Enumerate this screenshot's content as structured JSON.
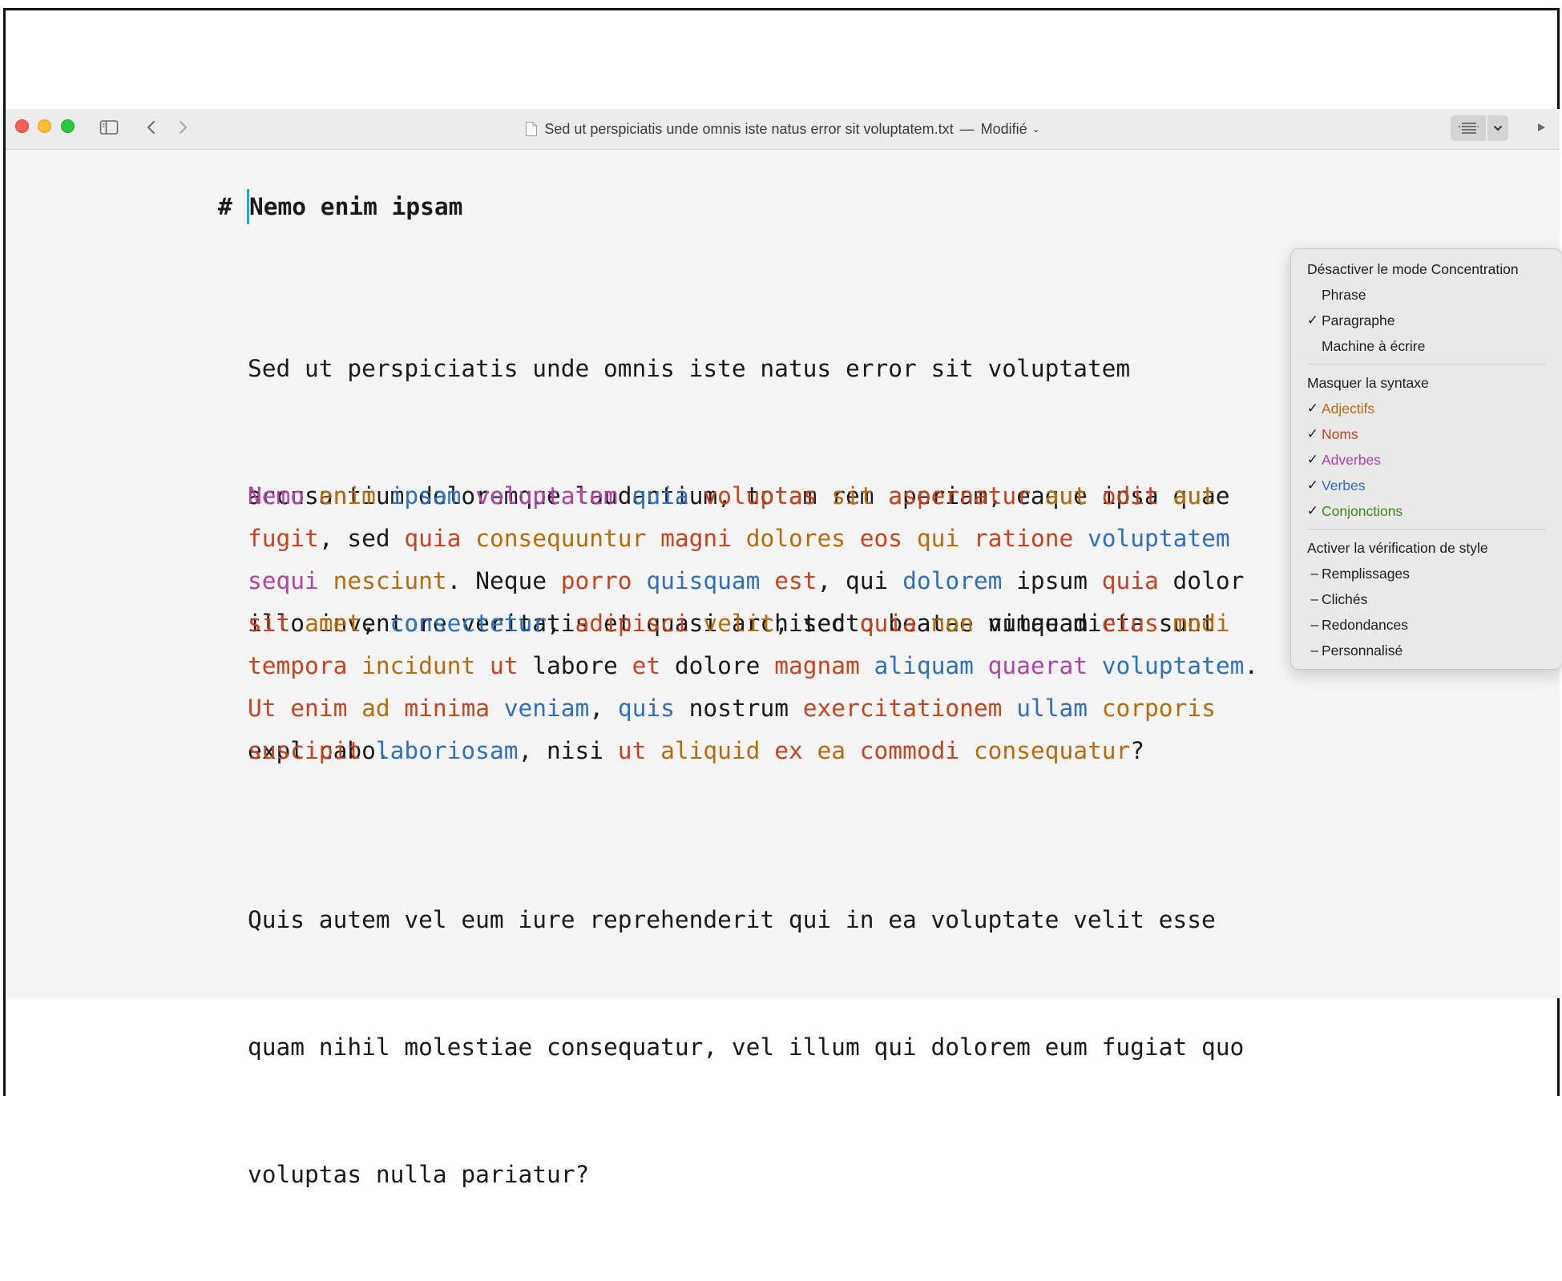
{
  "window": {
    "title": "Sed ut perspiciatis unde omnis iste natus error sit voluptatem.txt",
    "title_separator": "—",
    "status": "Modifié",
    "status_chevron": "⌄"
  },
  "toolbar": {
    "sidebar_icon": "sidebar-icon",
    "back_icon": "chevron-left-icon",
    "forward_icon": "chevron-right-icon",
    "focus_icon": "focus-mode-icon",
    "dropdown_icon": "chevron-down-icon",
    "play_icon": "play-icon"
  },
  "colors": {
    "nouns": "#c8431d",
    "adjectives": "#b96b0c",
    "adverbs": "#b341a8",
    "verbs": "#2f6fbf",
    "conjunctions": "#3b8a1c",
    "caret": "#1aa7e8"
  },
  "editor": {
    "heading_marker": "#",
    "heading_text": "Nemo enim ipsam",
    "paragraph1": [
      "Sed ut perspiciatis unde omnis iste natus error sit voluptatem",
      "accusantium doloremque laudantium, totam rem aperiam, eaque ipsa quae",
      "illo inventore veritatis et quasi architecto beatae vitae dicta sunt",
      "explicabo."
    ],
    "paragraph2": [
      [
        [
          "Nemo",
          "adv"
        ],
        [
          " ",
          "plain"
        ],
        [
          "enim",
          "adj"
        ],
        [
          " ",
          "plain"
        ],
        [
          "ipsam",
          "verb"
        ],
        [
          " ",
          "plain"
        ],
        [
          "voluptatem",
          "adv"
        ],
        [
          " ",
          "plain"
        ],
        [
          "quia",
          "verb"
        ],
        [
          " ",
          "plain"
        ],
        [
          "voluptas",
          "noun"
        ],
        [
          " ",
          "plain"
        ],
        [
          "sit",
          "adj"
        ],
        [
          " ",
          "plain"
        ],
        [
          "aspernatur",
          "noun"
        ],
        [
          " ",
          "plain"
        ],
        [
          "aut",
          "adj"
        ],
        [
          " ",
          "plain"
        ],
        [
          "odit",
          "noun"
        ],
        [
          " ",
          "plain"
        ],
        [
          "aut",
          "adj"
        ]
      ],
      [
        [
          "fugit",
          "noun"
        ],
        [
          ", sed ",
          "plain"
        ],
        [
          "quia",
          "noun"
        ],
        [
          " ",
          "plain"
        ],
        [
          "consequuntur",
          "adj"
        ],
        [
          " ",
          "plain"
        ],
        [
          "magni",
          "noun"
        ],
        [
          " ",
          "plain"
        ],
        [
          "dolores",
          "adj"
        ],
        [
          " ",
          "plain"
        ],
        [
          "eos",
          "noun"
        ],
        [
          " ",
          "plain"
        ],
        [
          "qui",
          "adj"
        ],
        [
          " ",
          "plain"
        ],
        [
          "ratione",
          "noun"
        ],
        [
          " ",
          "plain"
        ],
        [
          "voluptatem",
          "verb"
        ]
      ],
      [
        [
          "sequi",
          "adv"
        ],
        [
          " ",
          "plain"
        ],
        [
          "nesciunt",
          "adj"
        ],
        [
          ". Neque ",
          "plain"
        ],
        [
          "porro",
          "noun"
        ],
        [
          " ",
          "plain"
        ],
        [
          "quisquam",
          "verb"
        ],
        [
          " ",
          "plain"
        ],
        [
          "est",
          "noun"
        ],
        [
          ", qui ",
          "plain"
        ],
        [
          "dolorem",
          "verb"
        ],
        [
          " ipsum ",
          "plain"
        ],
        [
          "quia",
          "noun"
        ],
        [
          " dolor",
          "plain"
        ]
      ],
      [
        [
          "sit",
          "noun"
        ],
        [
          " ",
          "plain"
        ],
        [
          "amet",
          "adj"
        ],
        [
          ", ",
          "plain"
        ],
        [
          "consectetur",
          "verb"
        ],
        [
          ", ",
          "plain"
        ],
        [
          "adipisci",
          "noun"
        ],
        [
          " ",
          "plain"
        ],
        [
          "velit",
          "adj"
        ],
        [
          ", sed ",
          "plain"
        ],
        [
          "quia",
          "noun"
        ],
        [
          " ",
          "plain"
        ],
        [
          "non",
          "adj"
        ],
        [
          " numquam ",
          "plain"
        ],
        [
          "eius",
          "noun"
        ],
        [
          " ",
          "plain"
        ],
        [
          "modi",
          "adj"
        ]
      ],
      [
        [
          "tempora",
          "noun"
        ],
        [
          " ",
          "plain"
        ],
        [
          "incidunt",
          "adj"
        ],
        [
          " ",
          "plain"
        ],
        [
          "ut",
          "noun"
        ],
        [
          " labore ",
          "plain"
        ],
        [
          "et",
          "noun"
        ],
        [
          " dolore ",
          "plain"
        ],
        [
          "magnam",
          "noun"
        ],
        [
          " ",
          "plain"
        ],
        [
          "aliquam",
          "verb"
        ],
        [
          " ",
          "plain"
        ],
        [
          "quaerat",
          "adv"
        ],
        [
          " ",
          "plain"
        ],
        [
          "voluptatem",
          "verb"
        ],
        [
          ".",
          "plain"
        ]
      ],
      [
        [
          "Ut",
          "noun"
        ],
        [
          " ",
          "plain"
        ],
        [
          "enim",
          "noun"
        ],
        [
          " ",
          "plain"
        ],
        [
          "ad",
          "adj"
        ],
        [
          " ",
          "plain"
        ],
        [
          "minima",
          "noun"
        ],
        [
          " ",
          "plain"
        ],
        [
          "veniam",
          "verb"
        ],
        [
          ", ",
          "plain"
        ],
        [
          "quis",
          "verb"
        ],
        [
          " nostrum ",
          "plain"
        ],
        [
          "exercitationem",
          "noun"
        ],
        [
          " ",
          "plain"
        ],
        [
          "ullam",
          "verb"
        ],
        [
          " ",
          "plain"
        ],
        [
          "corporis",
          "adj"
        ]
      ],
      [
        [
          "suscipit",
          "noun"
        ],
        [
          " ",
          "plain"
        ],
        [
          "laboriosam",
          "verb"
        ],
        [
          ", nisi ",
          "plain"
        ],
        [
          "ut",
          "noun"
        ],
        [
          " ",
          "plain"
        ],
        [
          "aliquid",
          "adj"
        ],
        [
          " ",
          "plain"
        ],
        [
          "ex",
          "noun"
        ],
        [
          " ",
          "plain"
        ],
        [
          "ea",
          "adj"
        ],
        [
          " ",
          "plain"
        ],
        [
          "commodi",
          "noun"
        ],
        [
          " ",
          "plain"
        ],
        [
          "consequatur",
          "adj"
        ],
        [
          "?",
          "plain"
        ]
      ]
    ],
    "paragraph3": [
      "Quis autem vel eum iure reprehenderit qui in ea voluptate velit esse",
      "quam nihil molestiae consequatur, vel illum qui dolorem eum fugiat quo",
      "voluptas nulla pariatur?"
    ]
  },
  "menu": {
    "focus_header": "Désactiver le mode Concentration",
    "focus_items": [
      {
        "mark": "",
        "label": "Phrase"
      },
      {
        "mark": "✓",
        "label": "Paragraphe"
      },
      {
        "mark": "",
        "label": "Machine à écrire"
      }
    ],
    "syntax_header": "Masquer la syntaxe",
    "syntax_items": [
      {
        "mark": "✓",
        "label": "Adjectifs",
        "color": "#b96b0c"
      },
      {
        "mark": "✓",
        "label": "Noms",
        "color": "#c8431d"
      },
      {
        "mark": "✓",
        "label": "Adverbes",
        "color": "#b341a8"
      },
      {
        "mark": "✓",
        "label": "Verbes",
        "color": "#2f6fbf"
      },
      {
        "mark": "✓",
        "label": "Conjonctions",
        "color": "#3b8a1c"
      }
    ],
    "style_header": "Activer la vérification de style",
    "style_items": [
      {
        "mark": "–",
        "label": "Remplissages"
      },
      {
        "mark": "–",
        "label": "Clichés"
      },
      {
        "mark": "–",
        "label": "Redondances"
      },
      {
        "mark": "–",
        "label": "Personnalisé"
      }
    ]
  }
}
